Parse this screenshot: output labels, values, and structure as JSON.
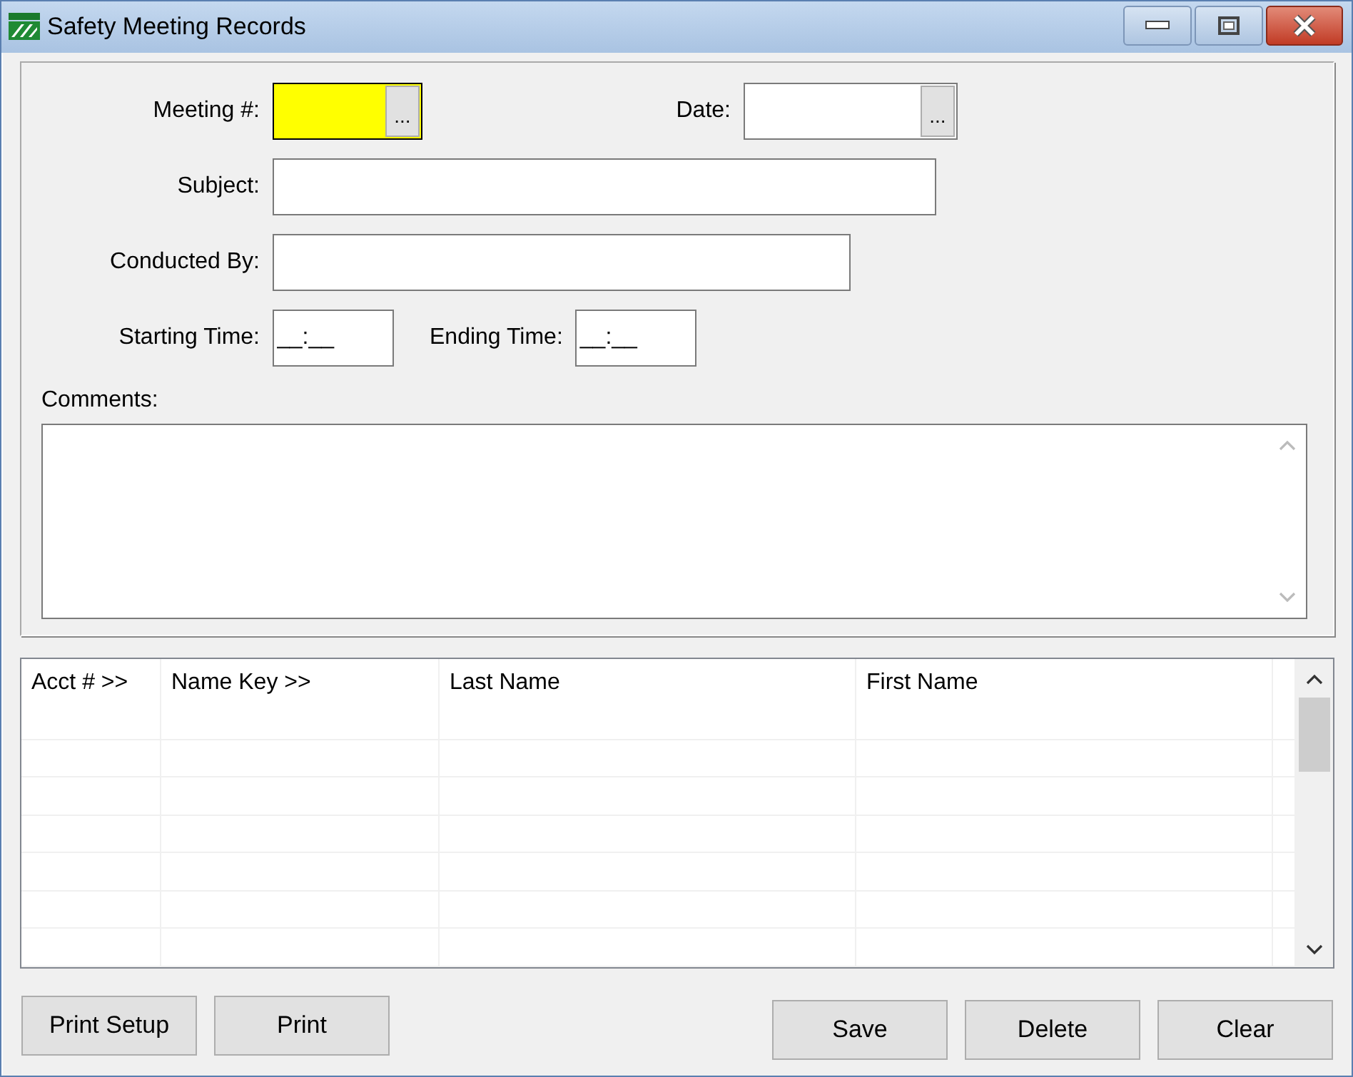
{
  "window": {
    "title": "Safety Meeting Records"
  },
  "form": {
    "meeting": {
      "label": "Meeting #:",
      "button": "...",
      "highlighted": true
    },
    "date": {
      "label": "Date:",
      "button": "..."
    },
    "subject": {
      "label": "Subject:"
    },
    "conducted_by": {
      "label": "Conducted By:"
    },
    "starting_time": {
      "label": "Starting Time:",
      "value": "__:__"
    },
    "ending_time": {
      "label": "Ending Time:",
      "value": "__:__"
    },
    "comments": {
      "label": "Comments:"
    }
  },
  "table": {
    "columns": [
      "Acct # >>",
      "Name Key >>",
      "Last Name",
      "First Name"
    ]
  },
  "buttons_left": [
    "Print Setup",
    "Print"
  ],
  "buttons_right": [
    "Save",
    "Delete",
    "Clear"
  ]
}
